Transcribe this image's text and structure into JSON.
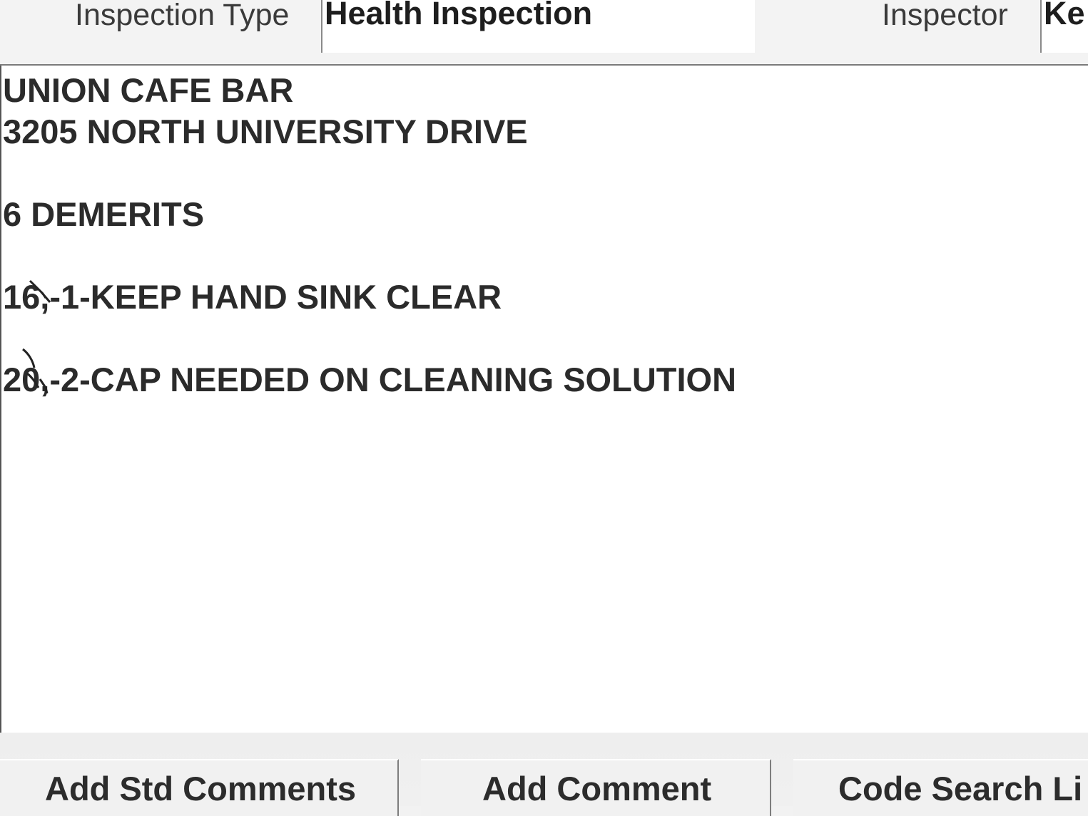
{
  "header": {
    "inspection_type_label": "Inspection Type",
    "inspection_type_value": "Health Inspection",
    "inspector_label": "Inspector",
    "inspector_value": "Ke"
  },
  "comments": {
    "lines": [
      "UNION CAFE BAR",
      "3205 NORTH UNIVERSITY DRIVE",
      "",
      "6 DEMERITS",
      "",
      "16,-1-KEEP HAND SINK CLEAR",
      "",
      "20,-2-CAP NEEDED ON CLEANING SOLUTION"
    ]
  },
  "buttons": {
    "add_std_comments": "Add Std Comments",
    "add_comment": "Add Comment",
    "code_search": "Code Search Li"
  },
  "colors": {
    "text": "#2b2b2b",
    "field_bg": "#ffffff",
    "chrome_bg": "#f2f2f2"
  }
}
